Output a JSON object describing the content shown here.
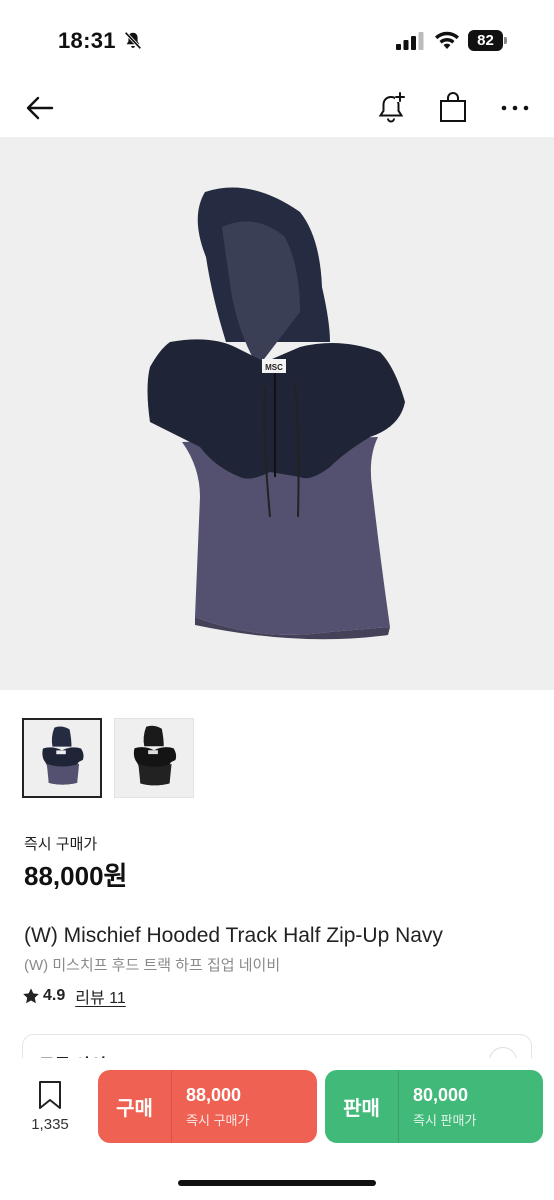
{
  "status_bar": {
    "time": "18:31",
    "battery": "82"
  },
  "product": {
    "thumbnails": [
      "navy-thumbnail",
      "black-thumbnail"
    ],
    "price_label": "즉시 구매가",
    "price": "88,000원",
    "title_en": "(W) Mischief Hooded Track Half Zip-Up Navy",
    "title_ko": "(W) 미스치프 후드 트랙 하프 집업 네이비",
    "rating": "4.9",
    "reviews": "리뷰 11",
    "size_label": "모든 사이즈"
  },
  "bottom_bar": {
    "wishlist_count": "1,335",
    "buy": {
      "label": "구매",
      "price": "88,000",
      "sub": "즉시 구매가",
      "color": "#ef6253"
    },
    "sell": {
      "label": "판매",
      "price": "80,000",
      "sub": "즉시 판매가",
      "color": "#41b979"
    }
  },
  "icons": [
    "bell-off-icon",
    "signal-icon",
    "wifi-icon",
    "back-arrow-icon",
    "bell-plus-icon",
    "shopping-bag-icon",
    "more-icon",
    "star-icon",
    "bookmark-icon"
  ]
}
